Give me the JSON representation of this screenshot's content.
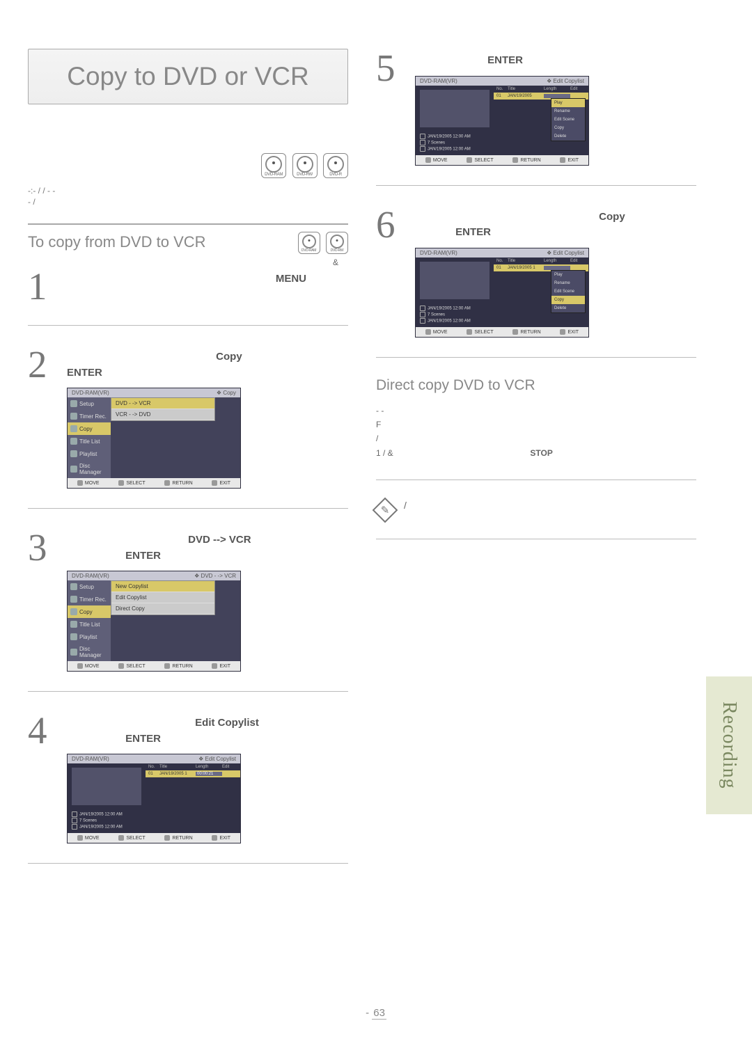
{
  "title": "Copy to DVD or VCR",
  "discs_top": [
    "DVD-RAM",
    "DVD-RW",
    "DVD-R"
  ],
  "meta_line1": "-:- /  /  - -",
  "meta_line2": "- /",
  "section_head": "To copy from DVD to VCR",
  "discs_section": [
    "DVD-RAM",
    "DVD-RW"
  ],
  "amp_line": "&",
  "steps_left": [
    {
      "num": "1",
      "text_suffix": "MENU"
    },
    {
      "num": "2",
      "label": "Copy",
      "enter": "ENTER"
    },
    {
      "num": "3",
      "label": "DVD --> VCR",
      "enter": "ENTER"
    },
    {
      "num": "4",
      "label": "Edit Copylist",
      "enter": "ENTER"
    }
  ],
  "steps_right": [
    {
      "num": "5",
      "enter": "ENTER"
    },
    {
      "num": "6",
      "label": "Copy",
      "enter": "ENTER"
    }
  ],
  "osd_common": {
    "footer": [
      "MOVE",
      "SELECT",
      "RETURN",
      "EXIT"
    ]
  },
  "osd_step2": {
    "hdr_left": "DVD-RAM(VR)",
    "hdr_right": "❖ Copy",
    "menu": [
      "Setup",
      "Timer Rec.",
      "Copy",
      "Title List",
      "Playlist",
      "Disc Manager"
    ],
    "active_index": 2,
    "submenu": [
      "DVD - -> VCR",
      "VCR - -> DVD"
    ],
    "submenu_sel": 0
  },
  "osd_step3": {
    "hdr_left": "DVD-RAM(VR)",
    "hdr_right": "❖ DVD - -> VCR",
    "menu": [
      "Setup",
      "Timer Rec.",
      "Copy",
      "Title List",
      "Playlist",
      "Disc Manager"
    ],
    "active_index": 2,
    "submenu": [
      "New Copylist",
      "Edit Copylist",
      "Direct Copy"
    ],
    "submenu_sel": 0
  },
  "osd_step4": {
    "hdr_left": "DVD-RAM(VR)",
    "hdr_right": "❖ Edit Copylist",
    "cols": [
      "No.",
      "Title",
      "Length",
      "Edit"
    ],
    "row": {
      "no": "01",
      "title": "JAN/19/2005 1",
      "length": "00:00:21",
      "edit": ""
    },
    "info": [
      "JAN/19/2005 12:00 AM",
      "7 Scenes",
      "JAN/19/2005 12:00 AM"
    ]
  },
  "osd_step5": {
    "hdr_left": "DVD-RAM(VR)",
    "hdr_right": "❖ Edit Copylist",
    "cols": [
      "No.",
      "Title",
      "Length",
      "Edit"
    ],
    "row": {
      "no": "01",
      "title": "JAN/19/2005",
      "length": "",
      "edit": ""
    },
    "ctx": [
      "Play",
      "Rename",
      "Edit Scene",
      "Copy",
      "Delete"
    ],
    "ctx_sel": 0,
    "info": [
      "JAN/19/2005 12:00 AM",
      "7 Scenes",
      "JAN/19/2005 12:00 AM"
    ]
  },
  "osd_step6": {
    "hdr_left": "DVD-RAM(VR)",
    "hdr_right": "❖ Edit Copylist",
    "cols": [
      "No.",
      "Title",
      "Length",
      "Edit"
    ],
    "row": {
      "no": "01",
      "title": "JAN/19/2005 1",
      "length": "",
      "edit": ""
    },
    "ctx": [
      "Play",
      "Rename",
      "Edit Scene",
      "Copy",
      "Delete"
    ],
    "ctx_sel": 3,
    "info": [
      "JAN/19/2005 12:00 AM",
      "7 Scenes",
      "JAN/19/2005 12:00 AM"
    ]
  },
  "direct_head": "Direct copy DVD to VCR",
  "direct_lines": [
    "- -",
    "F",
    "/",
    "1 /   &"
  ],
  "stop_label": "STOP",
  "note_text": "/",
  "side_tab": "Recording",
  "footer_prefix": "- ",
  "page_num": "63"
}
